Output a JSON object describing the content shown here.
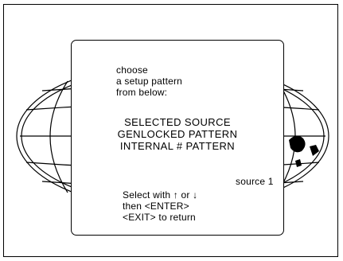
{
  "menu": {
    "instruction": [
      "choose",
      "a setup pattern",
      "from below:"
    ],
    "options": [
      "SELECTED SOURCE",
      "GENLOCKED PATTERN",
      "INTERNAL # PATTERN"
    ],
    "source_label": "source 1",
    "footer": {
      "select_prefix": "Select with",
      "or_word": "or",
      "enter_line": "then <ENTER>",
      "exit_line": "<EXIT> to return"
    }
  },
  "icons": {
    "up": "up-arrow-icon",
    "down": "down-arrow-icon",
    "background": "globe-logo-icon"
  },
  "colors": {
    "foreground": "#000000",
    "background": "#ffffff"
  }
}
